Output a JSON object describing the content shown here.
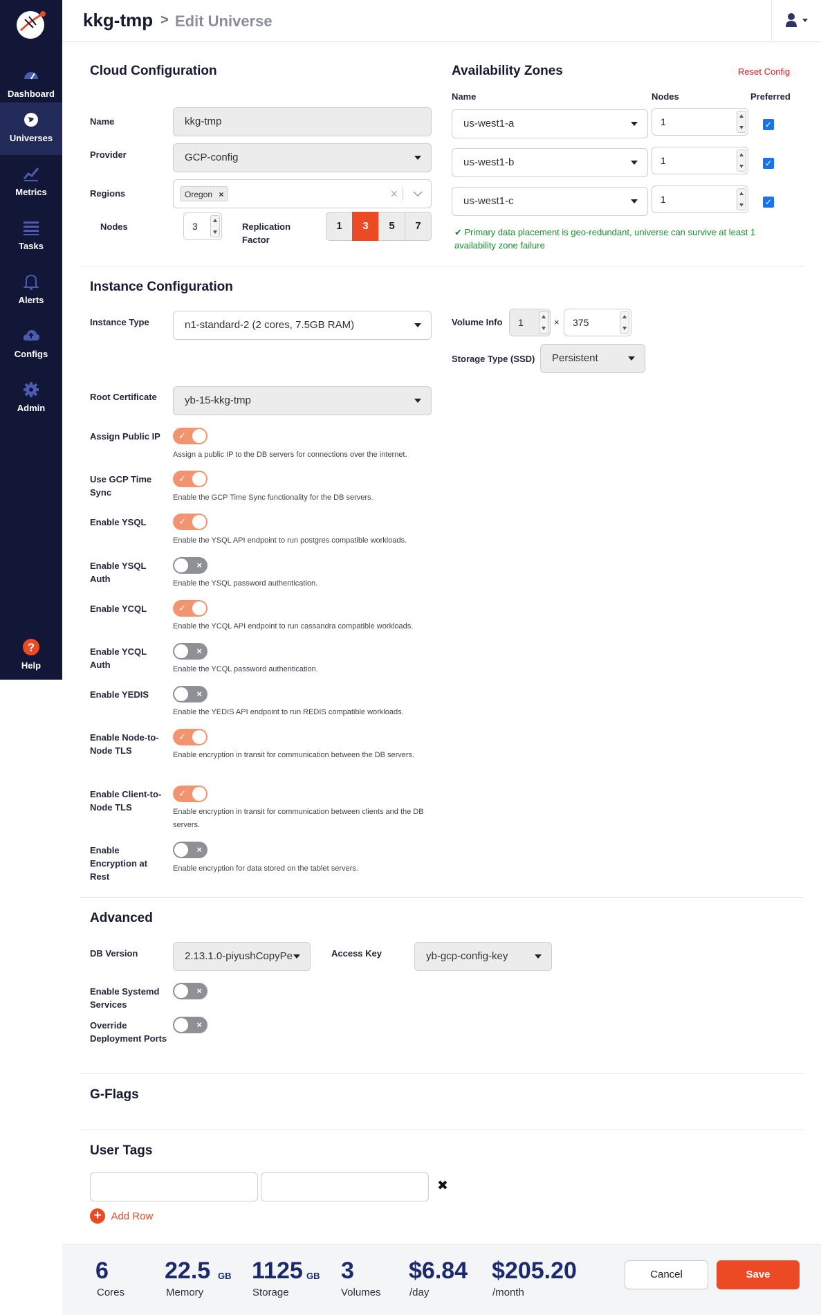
{
  "header": {
    "universe_name": "kkg-tmp",
    "separator": ">",
    "page": "Edit Universe"
  },
  "sidebar": {
    "items": [
      {
        "label": "Dashboard",
        "icon": "dashboard-icon"
      },
      {
        "label": "Universes",
        "icon": "globe-icon",
        "active": true
      },
      {
        "label": "Metrics",
        "icon": "chart-icon"
      },
      {
        "label": "Tasks",
        "icon": "list-icon"
      },
      {
        "label": "Alerts",
        "icon": "bell-icon"
      },
      {
        "label": "Configs",
        "icon": "cloud-upload-icon"
      },
      {
        "label": "Admin",
        "icon": "gear-icon"
      },
      {
        "label": "Help",
        "icon": "help-icon"
      }
    ]
  },
  "cloud": {
    "title": "Cloud Configuration",
    "name_label": "Name",
    "name_value": "kkg-tmp",
    "provider_label": "Provider",
    "provider_value": "GCP-config",
    "regions_label": "Regions",
    "region_tag": "Oregon",
    "nodes_label": "Nodes",
    "nodes_value": "3",
    "rf_label": "Replication Factor",
    "rf_options": [
      "1",
      "3",
      "5",
      "7"
    ],
    "rf_selected": "3"
  },
  "az": {
    "title": "Availability Zones",
    "reset": "Reset Config",
    "col_name": "Name",
    "col_nodes": "Nodes",
    "col_preferred": "Preferred",
    "rows": [
      {
        "zone": "us-west1-a",
        "nodes": "1",
        "preferred": true
      },
      {
        "zone": "us-west1-b",
        "nodes": "1",
        "preferred": true
      },
      {
        "zone": "us-west1-c",
        "nodes": "1",
        "preferred": true
      }
    ],
    "message": "Primary data placement is geo-redundant, universe can survive at least 1 availability zone failure",
    "message_color": "#1c8a2b"
  },
  "instance": {
    "title": "Instance Configuration",
    "type_label": "Instance Type",
    "type_value": "n1-standard-2 (2 cores, 7.5GB RAM)",
    "volume_label": "Volume Info",
    "volume_count": "1",
    "volume_times": "×",
    "volume_size": "375",
    "storage_label": "Storage Type (SSD)",
    "storage_value": "Persistent",
    "cert_label": "Root Certificate",
    "cert_value": "yb-15-kkg-tmp",
    "toggles": [
      {
        "label": "Assign Public IP",
        "desc": "Assign a public IP to the DB servers for connections over the internet.",
        "on": true
      },
      {
        "label": "Use GCP Time Sync",
        "desc": "Enable the GCP Time Sync functionality for the DB servers.",
        "on": true
      },
      {
        "label": "Enable YSQL",
        "desc": "Enable the YSQL API endpoint to run postgres compatible workloads.",
        "on": true
      },
      {
        "label": "Enable YSQL Auth",
        "desc": "Enable the YSQL password authentication.",
        "on": false
      },
      {
        "label": "Enable YCQL",
        "desc": "Enable the YCQL API endpoint to run cassandra compatible workloads.",
        "on": true
      },
      {
        "label": "Enable YCQL Auth",
        "desc": "Enable the YCQL password authentication.",
        "on": false
      },
      {
        "label": "Enable YEDIS",
        "desc": "Enable the YEDIS API endpoint to run REDIS compatible workloads.",
        "on": false
      },
      {
        "label": "Enable Node-to-Node TLS",
        "desc": "Enable encryption in transit for communication between the DB servers.",
        "on": true
      },
      {
        "label": "Enable Client-to-Node TLS",
        "desc": "Enable encryption in transit for communication between clients and the DB servers.",
        "on": true
      },
      {
        "label": "Enable Encryption at Rest",
        "desc": "Enable encryption for data stored on the tablet servers.",
        "on": false
      }
    ]
  },
  "advanced": {
    "title": "Advanced",
    "db_label": "DB Version",
    "db_value": "2.13.1.0-piyushCopyPe",
    "key_label": "Access Key",
    "key_value": "yb-gcp-config-key",
    "systemd_label": "Enable Systemd Services",
    "override_label": "Override Deployment Ports"
  },
  "gflags": {
    "title": "G-Flags"
  },
  "tags": {
    "title": "User Tags",
    "add_row": "Add Row"
  },
  "footer": {
    "cores": "6",
    "cores_lbl": "Cores",
    "memory": "22.5",
    "memory_unit": "GB",
    "memory_lbl": "Memory",
    "storage": "1125",
    "storage_unit": "GB",
    "storage_lbl": "Storage",
    "volumes": "3",
    "volumes_lbl": "Volumes",
    "per_day": "$6.84",
    "per_day_lbl": "/day",
    "per_month": "$205.20",
    "per_month_lbl": "/month",
    "cancel": "Cancel",
    "save": "Save"
  },
  "colors": {
    "accent": "#ec4a25",
    "sidebar": "#131737",
    "toggle_on": "#f1946f",
    "toggle_off": "#8f9096",
    "stat": "#1a2a6c"
  }
}
